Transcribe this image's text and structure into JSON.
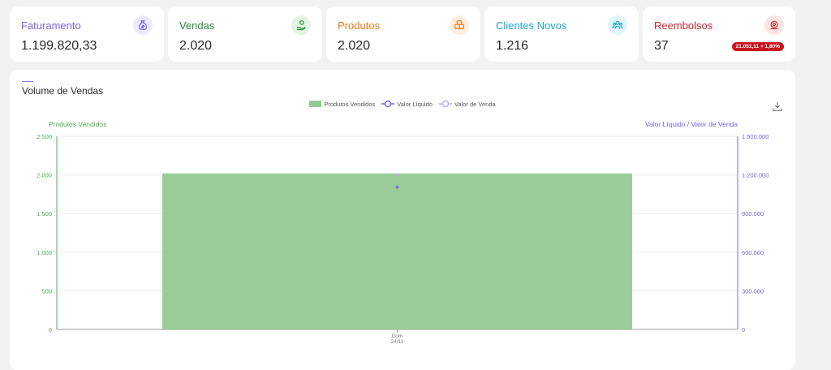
{
  "cards": [
    {
      "title": "Faturamento",
      "value": "1.199.820,33",
      "color": "#7b61e8",
      "bg": "#ede9fc",
      "icon": "money-bag-icon"
    },
    {
      "title": "Vendas",
      "value": "2.020",
      "color": "#2f8a3d",
      "bg": "#e3f4e5",
      "icon": "hand-coin-icon"
    },
    {
      "title": "Produtos",
      "value": "2.020",
      "color": "#ef7a1a",
      "bg": "#fdeee0",
      "icon": "boxes-icon"
    },
    {
      "title": "Clientes Novos",
      "value": "1.216",
      "color": "#1fa7c9",
      "bg": "#e1f5fa",
      "icon": "users-icon"
    },
    {
      "title": "Reembolsos",
      "value": "37",
      "color": "#d0242d",
      "bg": "#fbe4e5",
      "icon": "refund-icon",
      "badge": "21.051,11 + 1,80%"
    }
  ],
  "panel": {
    "title": "Volume de Vendas",
    "download_icon": "download-icon"
  },
  "legend": [
    {
      "label": "Produtos Vendidos",
      "color": "#93c993",
      "shape": "rect"
    },
    {
      "label": "Valor Líquido",
      "color": "#7b61e8",
      "shape": "circle-line"
    },
    {
      "label": "Valor de Venda",
      "color": "#b9aef2",
      "shape": "circle-line"
    }
  ],
  "chart_data": {
    "type": "bar",
    "categories": [
      "Dom 24/11"
    ],
    "x_tick_lines": [
      "Dom",
      "24/11"
    ],
    "series": [
      {
        "name": "Produtos Vendidos",
        "type": "bar",
        "axis": "left",
        "values": [
          2020
        ],
        "color": "#93c993"
      },
      {
        "name": "Valor Líquido",
        "type": "line",
        "axis": "right",
        "values": [
          1105000
        ],
        "color": "#7b61e8"
      },
      {
        "name": "Valor de Venda",
        "type": "line",
        "axis": "right",
        "values": [
          1199820.33
        ],
        "color": "#b9aef2"
      }
    ],
    "ylabel_left": "Produtos Vendidos",
    "ylabel_right": "Valor Líquido / Valor de Venda",
    "ylim_left": [
      0,
      2500
    ],
    "ylim_right": [
      0,
      1500000
    ],
    "yticks_left": [
      "0",
      "500",
      "1.000",
      "1.500",
      "2.000",
      "2.500"
    ],
    "yticks_right": [
      "0",
      "300.000",
      "600.000",
      "900.000",
      "1.200.000",
      "1.500.000"
    ],
    "left_axis_color": "#4caf50",
    "right_axis_color": "#7b61e8",
    "grid": true,
    "legend_position": "top-center"
  }
}
